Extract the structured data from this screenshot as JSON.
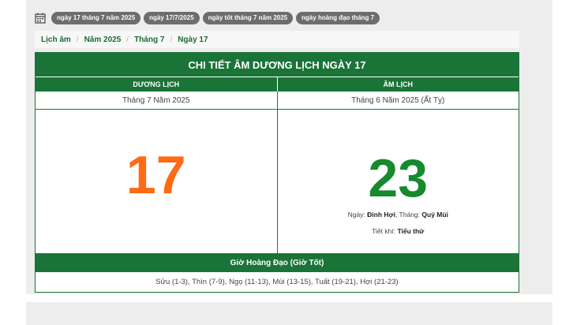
{
  "tags": [
    "ngày 17 tháng 7 năm 2025",
    "ngày 17/7/2025",
    "ngày tốt tháng 7 năm 2025",
    "ngày hoàng đạo tháng 7"
  ],
  "breadcrumb": [
    "Lịch âm",
    "Năm 2025",
    "Tháng 7",
    "Ngày 17"
  ],
  "table": {
    "title": "CHI TIẾT ÂM DƯƠNG LỊCH NGÀY 17",
    "solar_header": "DƯƠNG LỊCH",
    "lunar_header": "ÂM LỊCH",
    "solar_month": "Tháng 7 Năm 2025",
    "lunar_month": "Tháng 6 Năm 2025 (Ất Tỵ)",
    "solar_day": "17",
    "lunar_day": "23",
    "ngay_label": "Ngày:",
    "ngay_value": "Đinh Hợi",
    "thang_label": ", Tháng:",
    "thang_value": "Quý Mùi",
    "tietkhi_label": "Tiết khí:",
    "tietkhi_value": "Tiểu thử",
    "gio_title": "Giờ Hoàng Đạo (Giờ Tốt)",
    "gio_list": "Sửu (1-3), Thìn (7-9), Ngọ (11-13), Mùi (13-15), Tuất (19-21), Hợi (21-23)"
  },
  "colors": {
    "green": "#1a7437",
    "solar_day": "#ff6a13",
    "lunar_day": "#168a2d"
  }
}
